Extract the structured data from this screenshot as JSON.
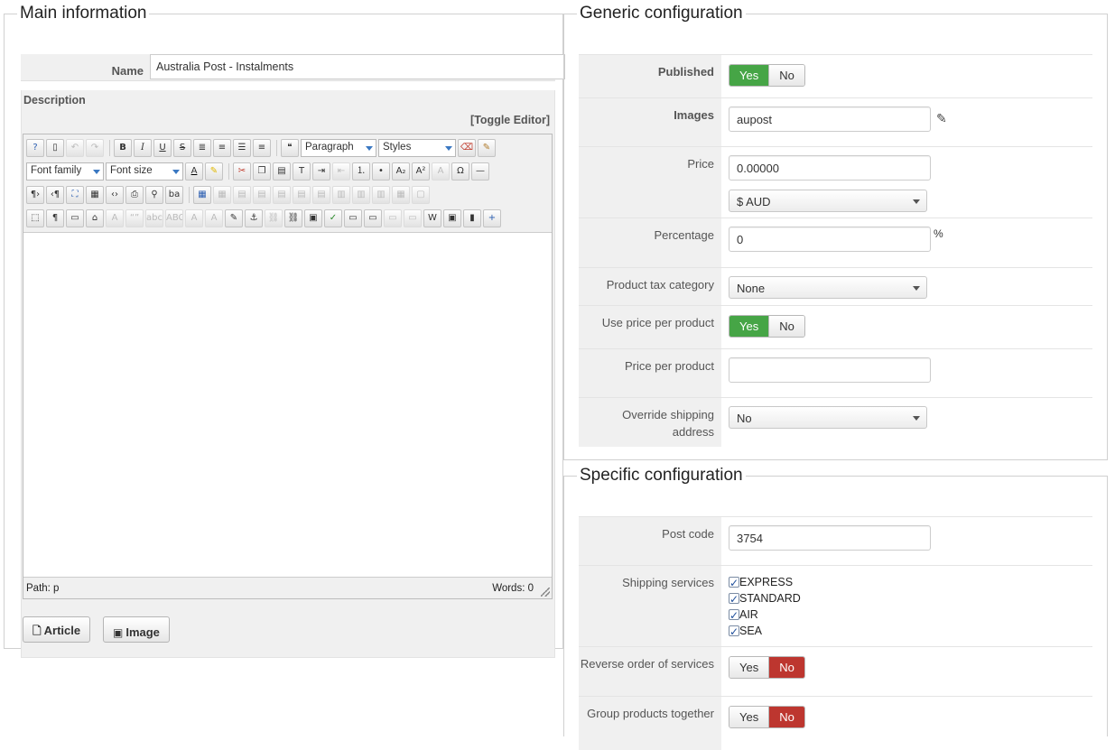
{
  "main": {
    "legend": "Main information",
    "name_label": "Name",
    "name_value": "Australia Post - Instalments",
    "description_label": "Description",
    "toggle_editor": "[Toggle Editor]",
    "editor": {
      "format_select": "Paragraph",
      "styles_select": "Styles",
      "font_family_select": "Font family",
      "font_size_select": "Font size",
      "path_label": "Path:  p",
      "words_label": "Words: 0"
    },
    "article_button": "Article",
    "image_button": "Image"
  },
  "generic": {
    "legend": "Generic configuration",
    "published": {
      "label": "Published",
      "yes": "Yes",
      "no": "No",
      "value": "Yes"
    },
    "images": {
      "label": "Images",
      "value": "aupost"
    },
    "price": {
      "label": "Price",
      "value": "0.00000",
      "currency": "$ AUD"
    },
    "percentage": {
      "label": "Percentage",
      "value": "0",
      "unit": "%"
    },
    "product_tax_category": {
      "label": "Product tax category",
      "value": "None"
    },
    "use_price_per_product": {
      "label": "Use price per product",
      "yes": "Yes",
      "no": "No",
      "value": "Yes"
    },
    "price_per_product": {
      "label": "Price per product",
      "value": ""
    },
    "override_shipping_address": {
      "label": "Override shipping address",
      "value": "No"
    }
  },
  "specific": {
    "legend": "Specific configuration",
    "post_code": {
      "label": "Post code",
      "value": "3754"
    },
    "shipping_services": {
      "label": "Shipping services",
      "options": [
        {
          "label": "EXPRESS",
          "checked": true
        },
        {
          "label": "STANDARD",
          "checked": true
        },
        {
          "label": "AIR",
          "checked": true
        },
        {
          "label": "SEA",
          "checked": true
        }
      ]
    },
    "reverse_order": {
      "label": "Reverse order of services",
      "yes": "Yes",
      "no": "No",
      "value": "No"
    },
    "group_products": {
      "label": "Group products together",
      "yes": "Yes",
      "no": "No",
      "value": "No"
    }
  },
  "colors": {
    "toggle_on_yes": "#46a546",
    "toggle_on_no": "#bd362f"
  }
}
